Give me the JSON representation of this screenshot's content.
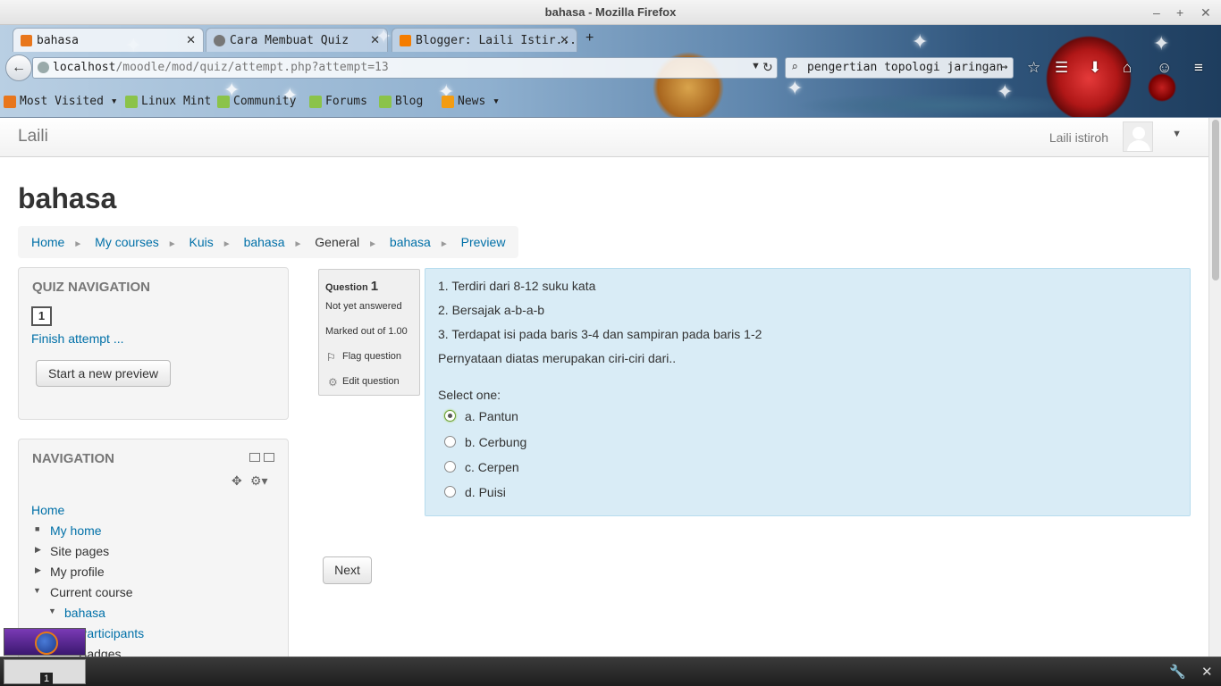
{
  "window": {
    "title": "bahasa - Mozilla Firefox"
  },
  "tabs": [
    {
      "label": "bahasa",
      "active": true
    },
    {
      "label": "Cara Membuat Quiz",
      "active": false
    },
    {
      "label": "Blogger: Laili Istir...",
      "active": false
    }
  ],
  "toolbar": {
    "url_host": "localhost",
    "url_path": "/moodle/mod/quiz/attempt.php?attempt=13",
    "search_value": "pengertian topologi jaringan",
    "new_tab": "+"
  },
  "bookmarks": [
    {
      "label": "Most Visited"
    },
    {
      "label": "Linux Mint"
    },
    {
      "label": "Community"
    },
    {
      "label": "Forums"
    },
    {
      "label": "Blog"
    },
    {
      "label": "News"
    }
  ],
  "moodle": {
    "brand": "Laili",
    "user_name": "Laili istiroh",
    "page_title": "bahasa",
    "breadcrumb": [
      "Home",
      "My courses",
      "Kuis",
      "bahasa",
      "General",
      "bahasa",
      "Preview"
    ],
    "quiz_nav": {
      "heading": "QUIZ NAVIGATION",
      "question_number": "1",
      "finish_label": "Finish attempt ...",
      "start_preview_label": "Start a new preview"
    },
    "navigation": {
      "heading": "NAVIGATION",
      "items": [
        "Home",
        "My home",
        "Site pages",
        "My profile",
        "Current course",
        "bahasa",
        "Participants",
        "Badges"
      ]
    },
    "question_info": {
      "label": "Question",
      "number": "1",
      "state": "Not yet answered",
      "marks": "Marked out of 1.00",
      "flag": "Flag question",
      "edit": "Edit question"
    },
    "question": {
      "lines": [
        "1. Terdiri dari 8-12 suku kata",
        "2. Bersajak a-b-a-b",
        "3. Terdapat isi pada baris 3-4 dan sampiran pada baris 1-2",
        "Pernyataan diatas merupakan ciri-ciri dari.."
      ],
      "prompt": "Select one:",
      "options": [
        "a. Pantun",
        "b. Cerbung",
        "c. Cerpen",
        "d. Puisi"
      ],
      "selected_index": 0
    },
    "next_label": "Next"
  },
  "taskbar": {
    "workspace": "1"
  },
  "colors": {
    "link": "#0070a8",
    "question_bg": "#d9ecf6",
    "block_bg": "#f5f5f5"
  }
}
